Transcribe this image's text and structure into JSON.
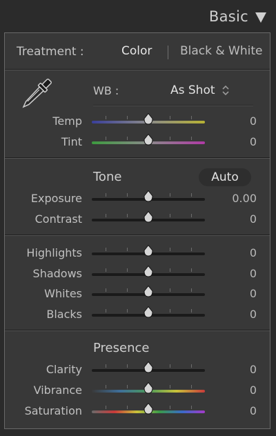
{
  "header": {
    "title": "Basic",
    "collapse_icon": "triangle-down-icon"
  },
  "treatment": {
    "label": "Treatment :",
    "options": [
      "Color",
      "Black & White"
    ],
    "selected": "Color"
  },
  "white_balance": {
    "tool_icon": "eyedropper-icon",
    "label": "WB :",
    "value": "As Shot",
    "sliders": [
      {
        "label": "Temp",
        "value": "0",
        "track": "temp-gradient"
      },
      {
        "label": "Tint",
        "value": "0",
        "track": "tint-gradient"
      }
    ]
  },
  "tone": {
    "title": "Tone",
    "auto_label": "Auto",
    "sliders": [
      {
        "label": "Exposure",
        "value": "0.00"
      },
      {
        "label": "Contrast",
        "value": "0"
      }
    ],
    "tonal_sliders": [
      {
        "label": "Highlights",
        "value": "0"
      },
      {
        "label": "Shadows",
        "value": "0"
      },
      {
        "label": "Whites",
        "value": "0"
      },
      {
        "label": "Blacks",
        "value": "0"
      }
    ]
  },
  "presence": {
    "title": "Presence",
    "sliders": [
      {
        "label": "Clarity",
        "value": "0",
        "track": "dark"
      },
      {
        "label": "Vibrance",
        "value": "0",
        "track": "vibrance-gradient"
      },
      {
        "label": "Saturation",
        "value": "0",
        "track": "saturation-gradient"
      }
    ]
  },
  "colors": {
    "panel_bg": "#383838",
    "temp_gradient": [
      "#3a3f9a",
      "#8a8a8a",
      "#b7b234"
    ],
    "tint_gradient": [
      "#3d9a3f",
      "#8a8a8a",
      "#b03aa6"
    ],
    "vibrance_gradient": [
      "#3a3a3a",
      "#3f6f9a",
      "#4a9a5a",
      "#c9c23a",
      "#c93a3a"
    ],
    "saturation_gradient": [
      "#6a6a6a",
      "#c93a3a",
      "#c9c23a",
      "#3a9a4a",
      "#3a6ac9",
      "#a43ac9"
    ]
  }
}
